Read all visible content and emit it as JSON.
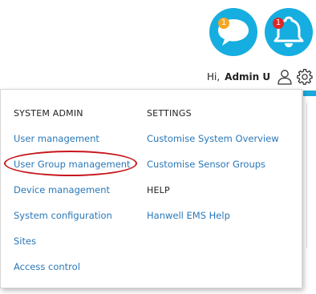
{
  "header": {
    "chat": {
      "icon": "speech-bubble-icon",
      "badge": "1",
      "badge_color": "#f5a623"
    },
    "notifications": {
      "icon": "bell-icon",
      "badge": "1",
      "badge_color": "#e02727"
    },
    "accent_color": "#16aee0",
    "greeting": "Hi,",
    "username": "Admin U",
    "user_icon": "user-icon",
    "settings_icon": "gear-icon"
  },
  "menu": {
    "system_admin": {
      "heading": "SYSTEM ADMIN",
      "items": [
        "User management",
        "User Group management",
        "Device management",
        "System configuration",
        "Sites",
        "Access control"
      ]
    },
    "settings": {
      "heading": "SETTINGS",
      "items": [
        "Customise System Overview",
        "Customise Sensor Groups"
      ]
    },
    "help": {
      "heading": "HELP",
      "items": [
        "Hanwell EMS Help"
      ]
    },
    "link_color": "#2a78b8",
    "highlight_color": "#c8161e"
  }
}
